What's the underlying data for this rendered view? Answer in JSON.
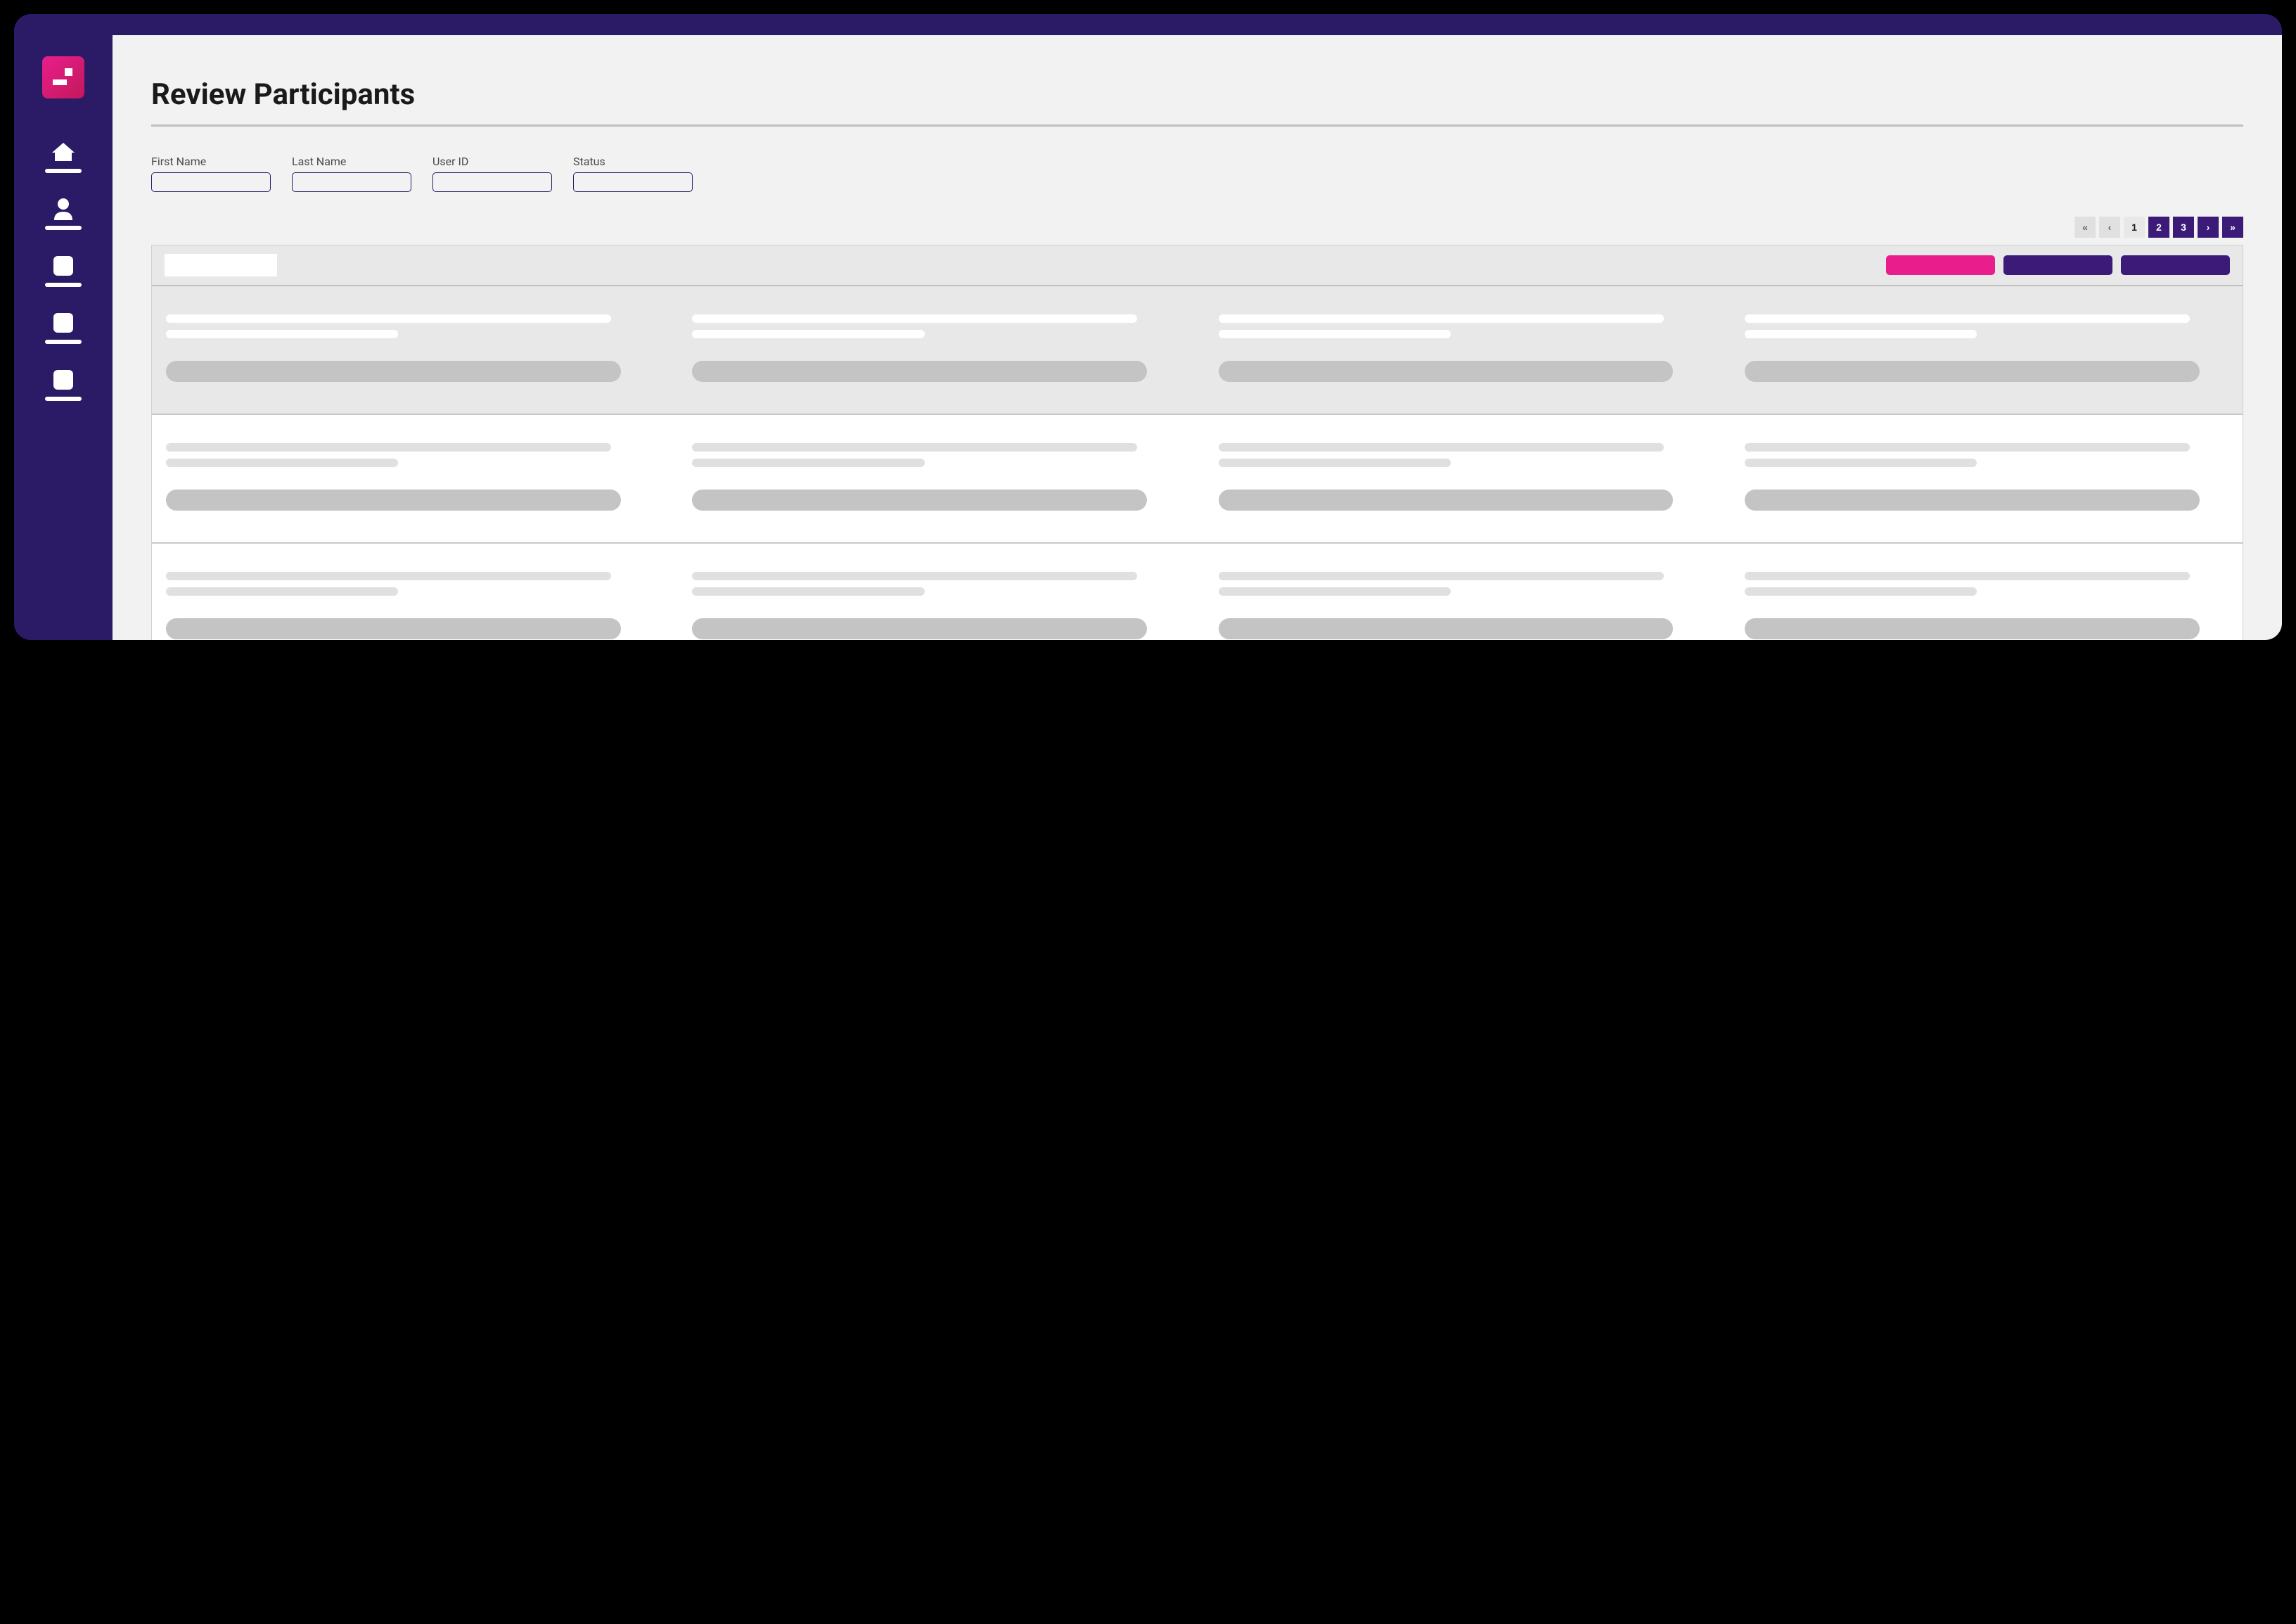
{
  "sidebar": {
    "nav_items": [
      {
        "icon": "home-icon"
      },
      {
        "icon": "user-icon"
      },
      {
        "icon": "square-icon"
      },
      {
        "icon": "square-icon"
      },
      {
        "icon": "square-icon"
      }
    ]
  },
  "page": {
    "title": "Review Participants"
  },
  "filters": [
    {
      "label": "First Name",
      "value": ""
    },
    {
      "label": "Last Name",
      "value": ""
    },
    {
      "label": "User ID",
      "value": ""
    },
    {
      "label": "Status",
      "value": ""
    }
  ],
  "pagination": {
    "first_icon": "«",
    "prev_icon": "‹",
    "next_icon": "›",
    "last_icon": "»",
    "pages": [
      "1",
      "2",
      "3"
    ],
    "current": "1"
  },
  "panel_header": {
    "actions": [
      {
        "style": "pink"
      },
      {
        "style": "purple"
      },
      {
        "style": "purple"
      }
    ]
  },
  "grid_rows": [
    {
      "shaded": true,
      "cards": 4,
      "line_style": "white"
    },
    {
      "shaded": false,
      "cards": 4,
      "line_style": "gray"
    },
    {
      "shaded": false,
      "cards": 4,
      "line_style": "gray"
    }
  ]
}
